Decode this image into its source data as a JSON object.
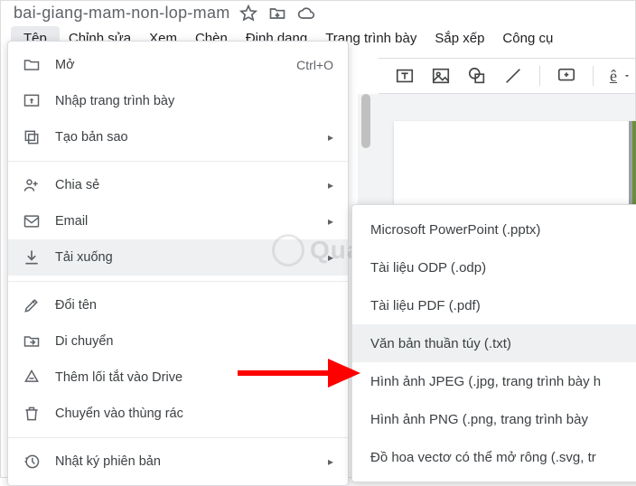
{
  "doc_title": "bai-giang-mam-non-lop-mam",
  "menubar": {
    "file": "Tệp",
    "edit": "Chỉnh sửa",
    "view": "Xem",
    "insert": "Chèn",
    "format": "Định dạng",
    "slide": "Trang trình bày",
    "arrange": "Sắp xếp",
    "tools": "Công cụ"
  },
  "file_menu": {
    "open": {
      "label": "Mở",
      "shortcut": "Ctrl+O"
    },
    "import_slides": {
      "label": "Nhập trang trình bày"
    },
    "make_copy": {
      "label": "Tạo bản sao"
    },
    "share": {
      "label": "Chia sẻ"
    },
    "email": {
      "label": "Email"
    },
    "download": {
      "label": "Tải xuống"
    },
    "rename": {
      "label": "Đổi tên"
    },
    "move": {
      "label": "Di chuyển"
    },
    "add_shortcut": {
      "label": "Thêm lối tắt vào Drive"
    },
    "move_to_trash": {
      "label": "Chuyển vào thùng rác"
    },
    "version_history": {
      "label": "Nhật ký phiên bản"
    }
  },
  "download_submenu": {
    "pptx": "Microsoft PowerPoint (.pptx)",
    "odp": "Tài liệu ODP (.odp)",
    "pdf": "Tài liệu PDF (.pdf)",
    "txt": "Văn bản thuần túy (.txt)",
    "jpg": "Hình ảnh JPEG (.jpg, trang trình bày h",
    "png": "Hình ảnh PNG (.png, trang trình bày",
    "svg": "Đồ hoa vectơ có thể mở rông (.svg, tr"
  },
  "toolbar_text_icon": "ê",
  "watermark_text": "Qua   tri   a  g"
}
